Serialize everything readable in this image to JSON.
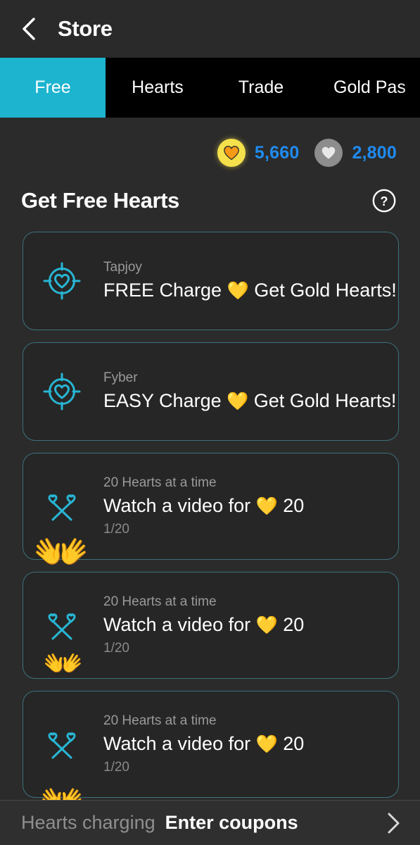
{
  "header": {
    "title": "Store",
    "back_icon": "chevron-left-icon"
  },
  "tabs": [
    {
      "label": "Free",
      "active": true
    },
    {
      "label": "Hearts",
      "active": false
    },
    {
      "label": "Trade",
      "active": false
    },
    {
      "label": "Gold Pas",
      "active": false
    }
  ],
  "currency": {
    "gold": {
      "icon": "gold-heart-coin-icon",
      "value": "5,660"
    },
    "silver": {
      "icon": "white-heart-coin-icon",
      "value": "2,800"
    }
  },
  "section": {
    "title": "Get Free Hearts",
    "help_icon": "question-mark-circle-icon"
  },
  "offers": [
    {
      "icon": "target-heart-icon",
      "provider": "Tapjoy",
      "title_pre": "FREE Charge ",
      "heart": "💛",
      "title_post": " Get Gold Hearts!",
      "progress": "",
      "hands": ""
    },
    {
      "icon": "target-heart-icon",
      "provider": "Fyber",
      "title_pre": "EASY Charge ",
      "heart": "💛",
      "title_post": " Get Gold Hearts!",
      "progress": "",
      "hands": ""
    },
    {
      "icon": "crossed-heart-wands-icon",
      "provider": "20 Hearts at a time",
      "title_pre": "Watch a video for ",
      "heart": "💛",
      "title_post": " 20",
      "progress": "1/20",
      "hands": "👐"
    },
    {
      "icon": "crossed-heart-wands-icon",
      "provider": "20 Hearts at a time",
      "title_pre": "Watch a video for ",
      "heart": "💛",
      "title_post": " 20",
      "progress": "1/20",
      "hands": "👐"
    },
    {
      "icon": "crossed-heart-wands-icon",
      "provider": "20 Hearts at a time",
      "title_pre": "Watch a video for ",
      "heart": "💛",
      "title_post": " 20",
      "progress": "1/20",
      "hands": "👐"
    }
  ],
  "bottom_bar": {
    "muted_label": "Hearts charging",
    "strong_label": "Enter coupons",
    "chevron_icon": "chevron-right-icon"
  },
  "colors": {
    "accent_cyan": "#1cb4cf",
    "card_border": "#3c717b",
    "value_blue": "#1f8bf0",
    "gold": "#f5e14b",
    "background": "#2b2b2b"
  }
}
